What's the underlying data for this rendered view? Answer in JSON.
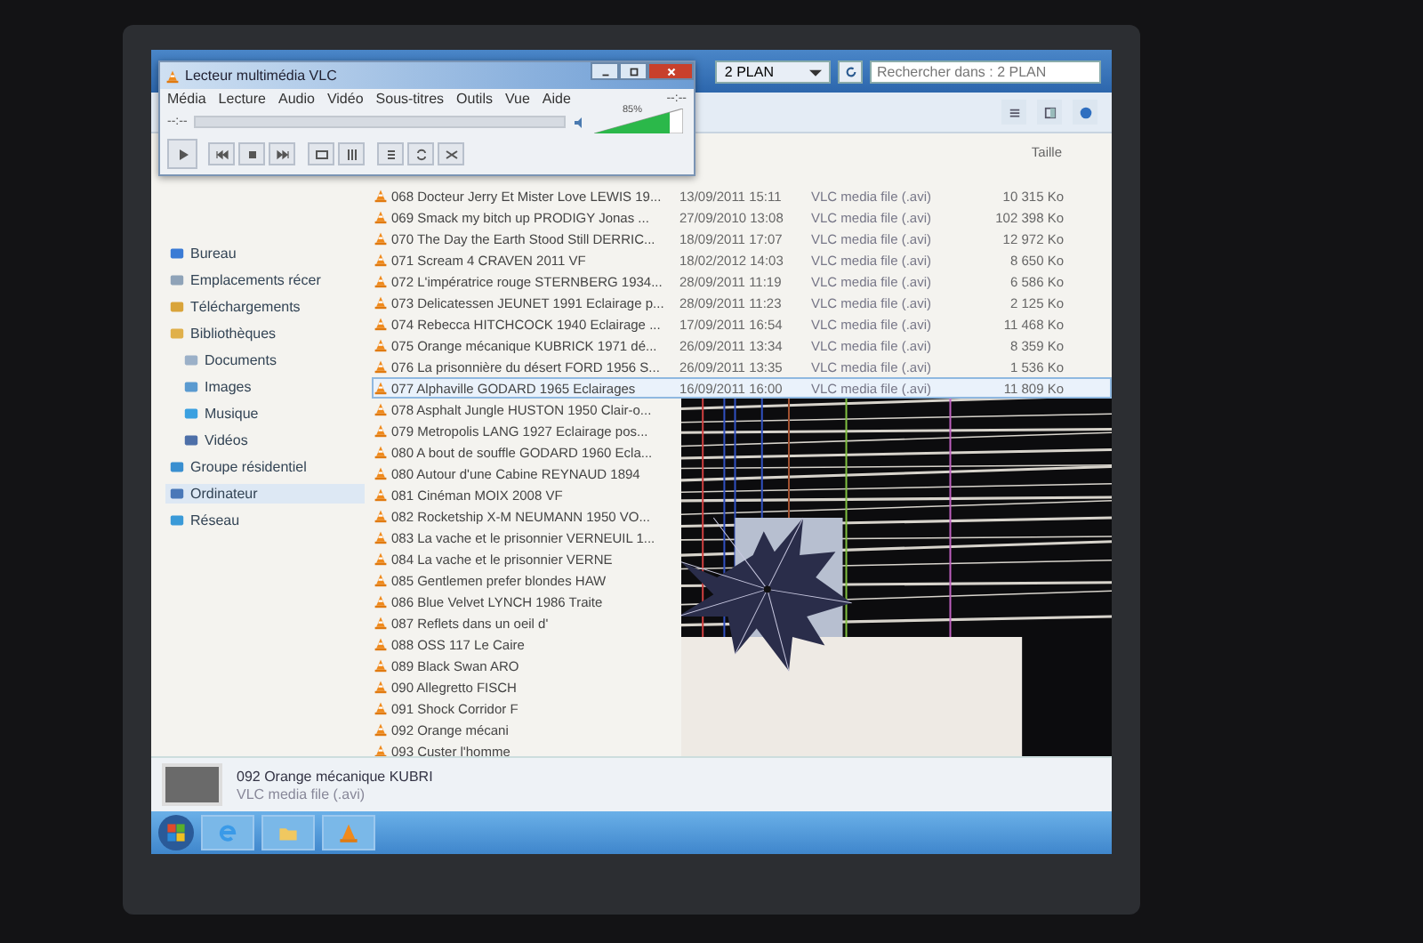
{
  "vlc": {
    "title": "Lecteur multimédia VLC",
    "menu": [
      "Média",
      "Lecture",
      "Audio",
      "Vidéo",
      "Sous-titres",
      "Outils",
      "Vue",
      "Aide"
    ],
    "time_elapsed": "--:--",
    "time_total": "--:--",
    "volume": {
      "level": 0.85,
      "reading": "85%"
    }
  },
  "explorer": {
    "address": "2 PLAN",
    "search": {
      "placeholder": "Rechercher dans : 2 PLAN"
    },
    "sidebar": [
      {
        "label": "Bureau",
        "selected": false
      },
      {
        "label": "Emplacements récer",
        "selected": false
      },
      {
        "label": "Téléchargements",
        "selected": false
      },
      {
        "label": "Bibliothèques",
        "selected": false,
        "children": [
          {
            "label": "Documents",
            "selected": false
          },
          {
            "label": "Images",
            "selected": false
          },
          {
            "label": "Musique",
            "selected": false
          },
          {
            "label": "Vidéos",
            "selected": false
          }
        ]
      },
      {
        "label": "Groupe résidentiel",
        "selected": false
      },
      {
        "label": "Ordinateur",
        "selected": true
      },
      {
        "label": "Réseau",
        "selected": false
      }
    ],
    "size_column": "Taille",
    "files": [
      {
        "name": "068 Docteur Jerry Et Mister Love LEWIS 19...",
        "date": "13/09/2011 15:11",
        "type": "VLC media file (.avi)",
        "size": "10 315 Ko",
        "selected": false
      },
      {
        "name": "069 Smack my bitch up PRODIGY Jonas ...",
        "date": "27/09/2010 13:08",
        "type": "VLC media file (.avi)",
        "size": "102 398 Ko",
        "selected": false
      },
      {
        "name": "070 The Day the Earth Stood Still DERRIC...",
        "date": "18/09/2011 17:07",
        "type": "VLC media file (.avi)",
        "size": "12 972 Ko",
        "selected": false
      },
      {
        "name": "071 Scream 4 CRAVEN 2011 VF",
        "date": "18/02/2012 14:03",
        "type": "VLC media file (.avi)",
        "size": "8 650 Ko",
        "selected": false
      },
      {
        "name": "072 L'impératrice rouge STERNBERG 1934...",
        "date": "28/09/2011 11:19",
        "type": "VLC media file (.avi)",
        "size": "6 586 Ko",
        "selected": false
      },
      {
        "name": "073 Delicatessen JEUNET 1991 Eclairage p...",
        "date": "28/09/2011 11:23",
        "type": "VLC media file (.avi)",
        "size": "2 125 Ko",
        "selected": false
      },
      {
        "name": "074 Rebecca HITCHCOCK 1940 Eclairage ...",
        "date": "17/09/2011 16:54",
        "type": "VLC media file (.avi)",
        "size": "11 468 Ko",
        "selected": false
      },
      {
        "name": "075 Orange mécanique KUBRICK 1971 dé...",
        "date": "26/09/2011 13:34",
        "type": "VLC media file (.avi)",
        "size": "8 359 Ko",
        "selected": false
      },
      {
        "name": "076 La prisonnière du désert FORD 1956 S...",
        "date": "26/09/2011 13:35",
        "type": "VLC media file (.avi)",
        "size": "1 536 Ko",
        "selected": false
      },
      {
        "name": "077 Alphaville GODARD 1965 Eclairages",
        "date": "16/09/2011 16:00",
        "type": "VLC media file (.avi)",
        "size": "11 809 Ko",
        "selected": true
      },
      {
        "name": "078 Asphalt Jungle HUSTON 1950 Clair-o...",
        "selected": false
      },
      {
        "name": "079 Metropolis LANG 1927 Eclairage pos...",
        "selected": false
      },
      {
        "name": "080 A bout de souffle GODARD 1960 Ecla...",
        "selected": false
      },
      {
        "name": "080 Autour d'une Cabine REYNAUD 1894",
        "selected": false
      },
      {
        "name": "081 Cinéman MOIX 2008 VF",
        "selected": false
      },
      {
        "name": "082 Rocketship X-M NEUMANN 1950 VO...",
        "selected": false
      },
      {
        "name": "083 La vache et le prisonnier VERNEUIL 1...",
        "selected": false
      },
      {
        "name": "084 La vache et le prisonnier VERNE",
        "selected": false
      },
      {
        "name": "085 Gentlemen prefer blondes HAW",
        "selected": false
      },
      {
        "name": "086 Blue Velvet LYNCH 1986 Traite",
        "selected": false
      },
      {
        "name": "087 Reflets dans un oeil d'",
        "selected": false
      },
      {
        "name": "088 OSS 117 Le Caire",
        "selected": false
      },
      {
        "name": "089 Black Swan ARO",
        "selected": false
      },
      {
        "name": "090 Allegretto FISCH",
        "selected": false
      },
      {
        "name": "091 Shock Corridor F",
        "selected": false
      },
      {
        "name": "092 Orange mécani",
        "selected": false
      },
      {
        "name": "093 Custer l'homme",
        "selected": false
      }
    ],
    "details": {
      "name": "092 Orange mécanique KUBRI",
      "type": "VLC media file (.avi)"
    }
  }
}
